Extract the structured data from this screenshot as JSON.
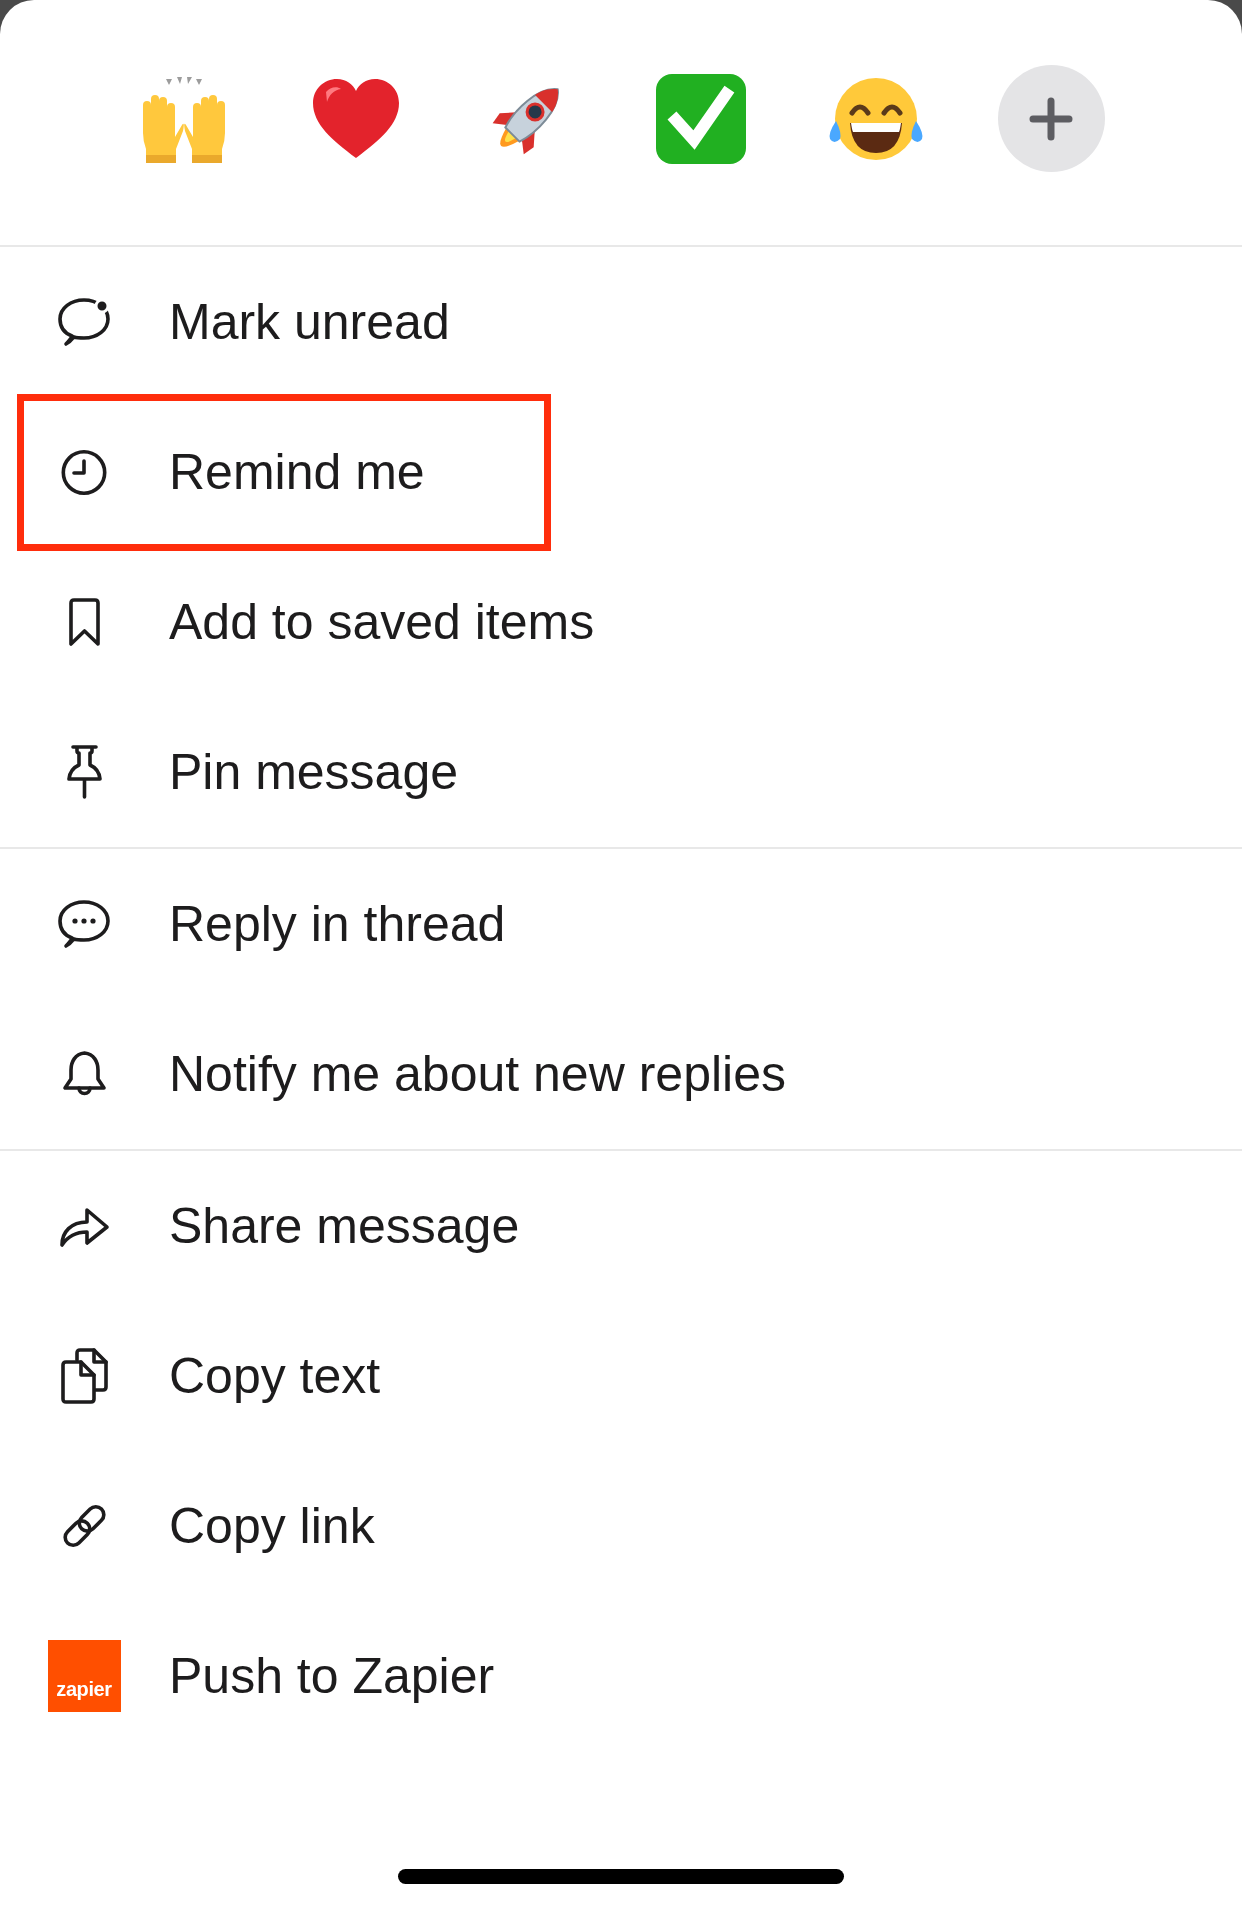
{
  "reactions": [
    {
      "kind": "raised-hands"
    },
    {
      "kind": "heart"
    },
    {
      "kind": "rocket"
    },
    {
      "kind": "check"
    },
    {
      "kind": "laughing"
    },
    {
      "kind": "add"
    }
  ],
  "menu": {
    "sections": [
      {
        "items": [
          {
            "kind": "unread",
            "label": "Mark unread",
            "highlighted": false
          },
          {
            "kind": "clock",
            "label": "Remind me",
            "highlighted": true
          },
          {
            "kind": "bookmark",
            "label": "Add to saved items",
            "highlighted": false
          },
          {
            "kind": "pin",
            "label": "Pin message",
            "highlighted": false
          }
        ]
      },
      {
        "items": [
          {
            "kind": "thread",
            "label": "Reply in thread",
            "highlighted": false
          },
          {
            "kind": "bell",
            "label": "Notify me about new replies",
            "highlighted": false
          }
        ]
      },
      {
        "items": [
          {
            "kind": "share",
            "label": "Share message",
            "highlighted": false
          },
          {
            "kind": "copy",
            "label": "Copy text",
            "highlighted": false
          },
          {
            "kind": "link",
            "label": "Copy link",
            "highlighted": false
          },
          {
            "kind": "app",
            "label": "Push to Zapier",
            "logo_text": "zapier",
            "highlighted": false
          }
        ]
      }
    ]
  }
}
